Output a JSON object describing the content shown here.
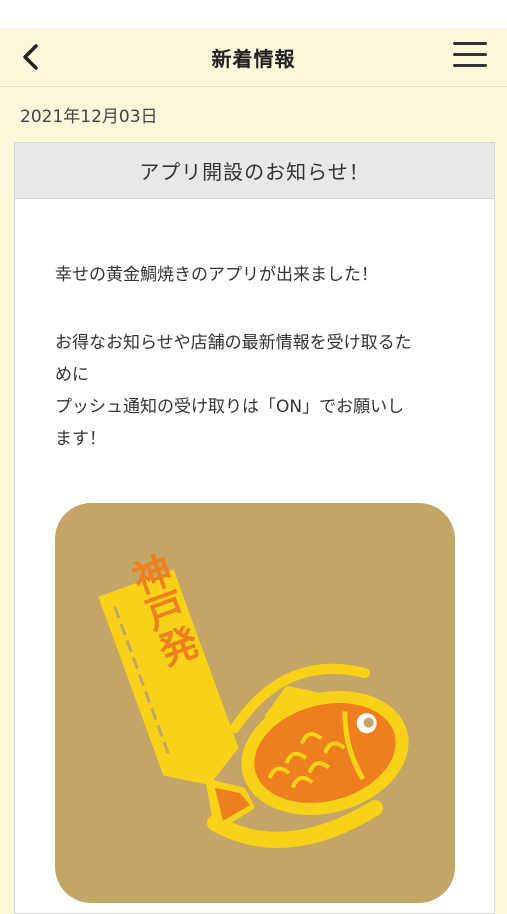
{
  "header": {
    "title": "新着情報",
    "back_icon": "chevron-left-icon",
    "menu_icon": "hamburger-menu-icon"
  },
  "news": {
    "date": "2021年12月03日",
    "title": "アプリ開設のお知らせ！",
    "body": {
      "line1": "幸せの黄金鯛焼きのアプリが出来ました！",
      "line2": "お得なお知らせや店舗の最新情報を受け取るた",
      "line3": "めに",
      "line4": "プッシュ通知の受け取りは「ON」でお願いし",
      "line5": "ます！"
    },
    "logo_text": "神戸発"
  },
  "colors": {
    "background": "#fbf8dc",
    "logo_bg": "#c5a567",
    "logo_yellow": "#f7d219",
    "logo_orange": "#ee7f1e"
  }
}
